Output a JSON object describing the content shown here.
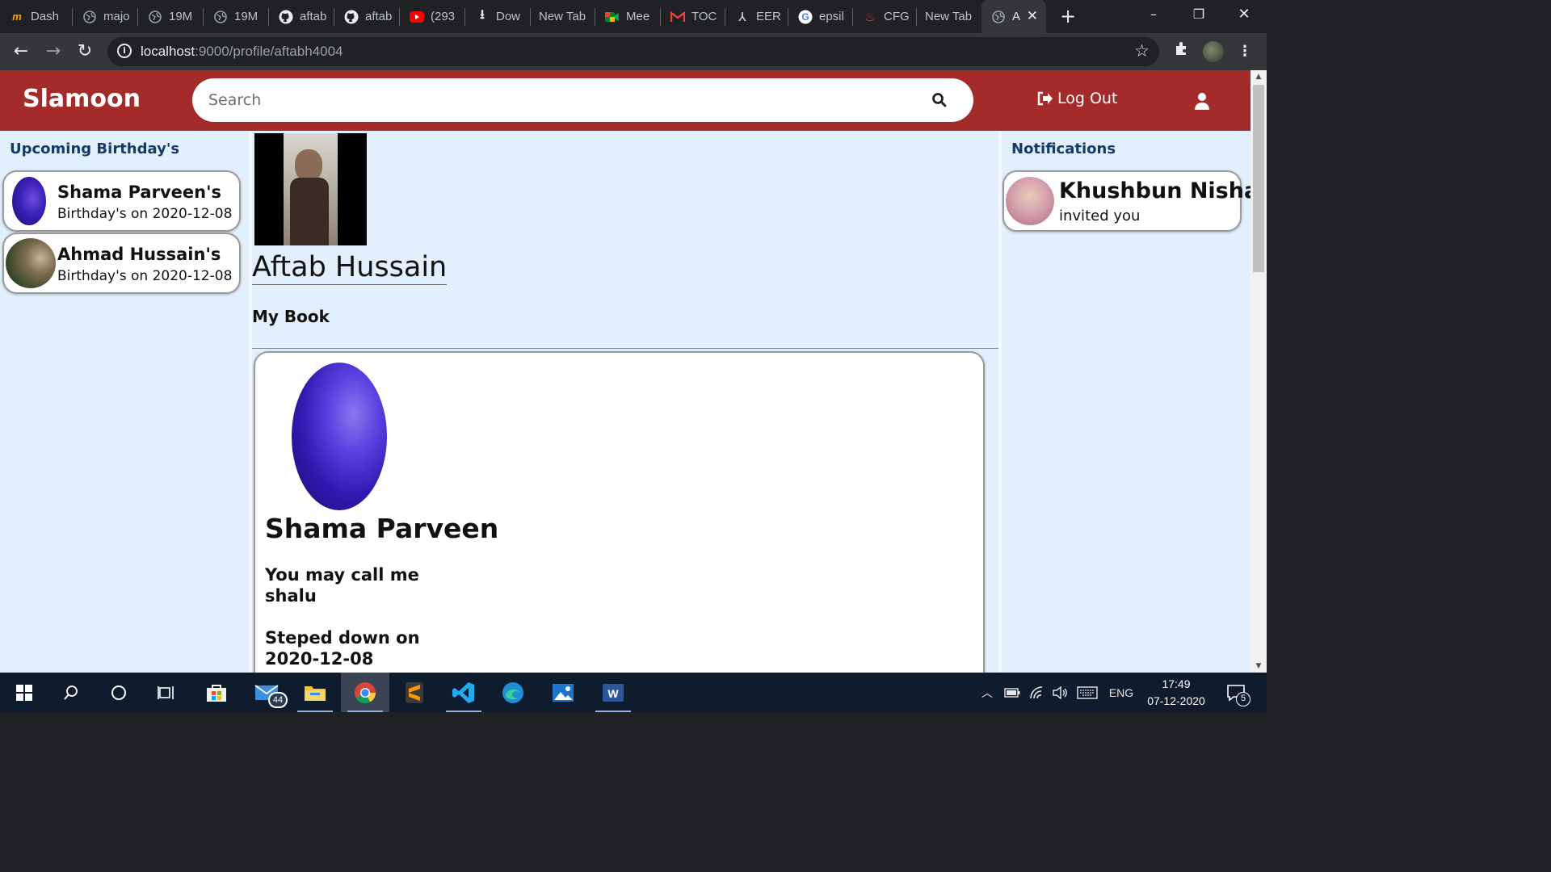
{
  "browser": {
    "tabs": [
      {
        "label": "Dash",
        "icon": "coursera-icon"
      },
      {
        "label": "majo",
        "icon": "globe-icon"
      },
      {
        "label": "19M",
        "icon": "globe-icon"
      },
      {
        "label": "19M",
        "icon": "globe-icon"
      },
      {
        "label": "aftab",
        "icon": "github-icon"
      },
      {
        "label": "aftab",
        "icon": "github-icon"
      },
      {
        "label": "(293",
        "icon": "youtube-icon"
      },
      {
        "label": "Dow",
        "icon": "download-icon"
      },
      {
        "label": "New Tab",
        "icon": ""
      },
      {
        "label": "Mee",
        "icon": "meet-icon"
      },
      {
        "label": "TOC",
        "icon": "gmail-icon"
      },
      {
        "label": "EER",
        "icon": "pdf-icon"
      },
      {
        "label": "epsil",
        "icon": "google-icon"
      },
      {
        "label": "CFG",
        "icon": "pdf-red-icon"
      },
      {
        "label": "New Tab",
        "icon": ""
      },
      {
        "label": "A",
        "icon": "globe-icon"
      }
    ],
    "url_host": "localhost",
    "url_path": ":9000/profile/aftabh4004"
  },
  "navbar": {
    "brand": "Slamoon",
    "search_placeholder": "Search",
    "logout_label": "Log Out",
    "bg_color": "#a52a2a"
  },
  "left": {
    "heading": "Upcoming Birthday's",
    "items": [
      {
        "name": "Shama Parveen's",
        "sub": "Birthday's on 2020-12-08"
      },
      {
        "name": "Ahmad Hussain's",
        "sub": "Birthday's on 2020-12-08"
      }
    ]
  },
  "right": {
    "heading": "Notifications",
    "items": [
      {
        "name": "Khushbun Nisha",
        "sub": "invited you"
      }
    ]
  },
  "profile": {
    "name": "Aftab Hussain",
    "section_title": "My Book",
    "entry": {
      "name": "Shama Parveen",
      "call_label": "You may call me",
      "call_value": "shalu",
      "stepped_label": "Steped down on",
      "stepped_value": "2020-12-08"
    }
  },
  "taskbar": {
    "mail_badge": "44",
    "language": "ENG",
    "time": "17:49",
    "date": "07-12-2020",
    "notif_count": "5"
  }
}
